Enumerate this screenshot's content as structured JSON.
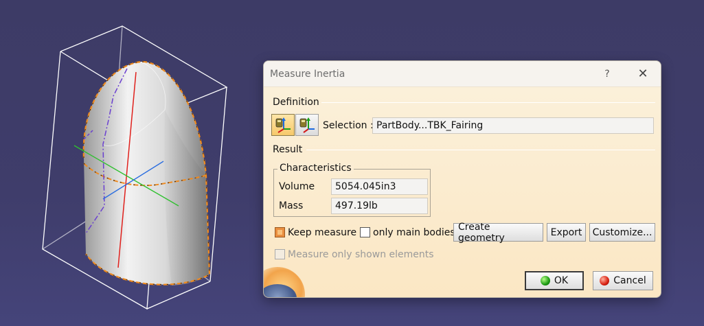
{
  "dialog": {
    "title": "Measure Inertia",
    "help_label": "?",
    "close_label": "✕",
    "definition_label": "Definition",
    "selection_label": "Selection :",
    "selection_value": "PartBody...TBK_Fairing",
    "result_label": "Result",
    "characteristics_label": "Characteristics",
    "volume_label": "Volume",
    "volume_value": "5054.045in3",
    "mass_label": "Mass",
    "mass_value": "497.19lb",
    "keep_measure_label": "Keep measure",
    "keep_measure_checked": true,
    "only_main_bodies_label": "only main bodies",
    "only_main_bodies_checked": false,
    "create_geometry_label": "Create geometry",
    "export_label": "Export",
    "customize_label": "Customize...",
    "measure_shown_label": "Measure only shown elements",
    "ok_label": "OK",
    "cancel_label": "Cancel"
  },
  "colors": {
    "background": "#3f3d6b",
    "dialog_bg": "#fbe9c8",
    "edge_highlight": "#f08a1e",
    "axis_red": "#e0201c",
    "axis_green": "#2ec02e",
    "axis_blue": "#2a6de0"
  },
  "icons": [
    "inertia-everything-icon",
    "inertia-surface-icon",
    "ok-icon",
    "cancel-icon"
  ]
}
